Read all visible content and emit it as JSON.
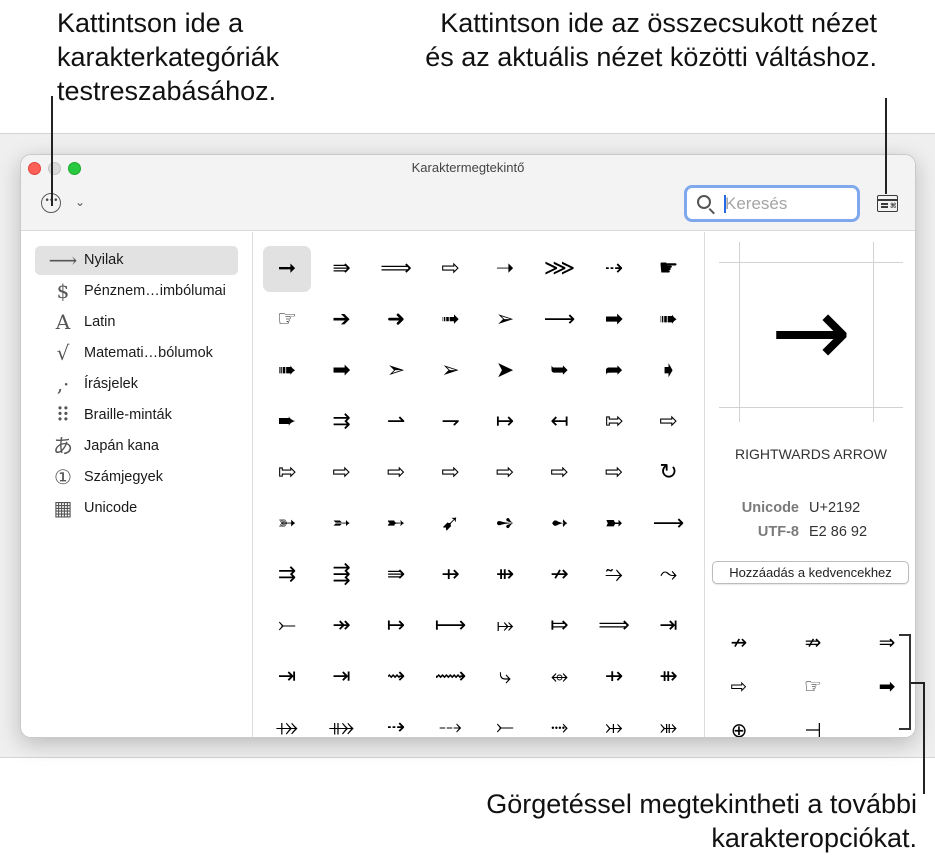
{
  "callouts": {
    "top_left": "Kattintson ide a karakterkategóriák testreszabásához.",
    "top_right": "Kattintson ide az összecsukott nézet és az aktuális nézet közötti váltáshoz.",
    "bottom_right": "Görgetéssel megtekintheti a további karakteropciókat."
  },
  "window": {
    "title": "Karaktermegtekintő"
  },
  "toolbar": {
    "more_icon": "ellipsis-circle-icon",
    "chevron_icon": "chevron-down-icon",
    "search_placeholder": "Keresés",
    "view_toggle_icon": "view-toggle-icon"
  },
  "sidebar": {
    "items": [
      {
        "icon": "⟶",
        "label": "Nyilak",
        "active": true
      },
      {
        "icon": "$",
        "label": "Pénznem…imbólumai"
      },
      {
        "icon": "A",
        "label": "Latin"
      },
      {
        "icon": "√",
        "label": "Matemati…bólumok"
      },
      {
        "icon": "‚·",
        "label": "Írásjelek"
      },
      {
        "icon": "⠿",
        "label": "Braille-minták"
      },
      {
        "icon": "あ",
        "label": "Japán kana"
      },
      {
        "icon": "①",
        "label": "Számjegyek"
      },
      {
        "icon": "▦",
        "label": "Unicode"
      }
    ]
  },
  "grid": {
    "rows": [
      [
        "➞",
        "⇛",
        "⟹",
        "⇨",
        "➝",
        "⋙",
        "⇢",
        "☛"
      ],
      [
        "☞",
        "➔",
        "➜",
        "➟",
        "➢",
        "⟶",
        "➡",
        "➠"
      ],
      [
        "➠",
        "➡",
        "➣",
        "➢",
        "➤",
        "➥",
        "➦",
        "➧"
      ],
      [
        "➨",
        "⇉",
        "⇀",
        "⇁",
        "↦",
        "↤",
        "⇰",
        "⇨"
      ],
      [
        "⇰",
        "⇨",
        "⇨",
        "⇨",
        "⇨",
        "⇨",
        "⇨",
        "↻"
      ],
      [
        "➳",
        "➵",
        "➸",
        "➹",
        "➺",
        "➻",
        "➼",
        "⟶"
      ],
      [
        "⇉",
        "⇶",
        "⇛",
        "⇸",
        "⇻",
        "↛",
        "⥲",
        "⤳"
      ],
      [
        "⤚",
        "↠",
        "↦",
        "⟼",
        "⤅",
        "⤇",
        "⟹",
        "⇥"
      ],
      [
        "⇥",
        "⇥",
        "⇝",
        "⟿",
        "⤷",
        "⥈",
        "⇸",
        "⇻"
      ],
      [
        "⤀",
        "⤁",
        "⇢",
        "⤏",
        "⤚",
        "⤑",
        "⤔",
        "⤕"
      ]
    ],
    "selected": "➞"
  },
  "detail": {
    "glyph": "→",
    "name": "RIGHTWARDS ARROW",
    "unicode_label": "Unicode",
    "unicode_value": "U+2192",
    "utf8_label": "UTF-8",
    "utf8_value": "E2 86 92",
    "favorite_button": "Hozzáadás a kedvencekhez",
    "related": [
      "↛",
      "⇏",
      "⇒",
      "⇨",
      "☞",
      "➡",
      "⊕",
      "⊣"
    ]
  }
}
